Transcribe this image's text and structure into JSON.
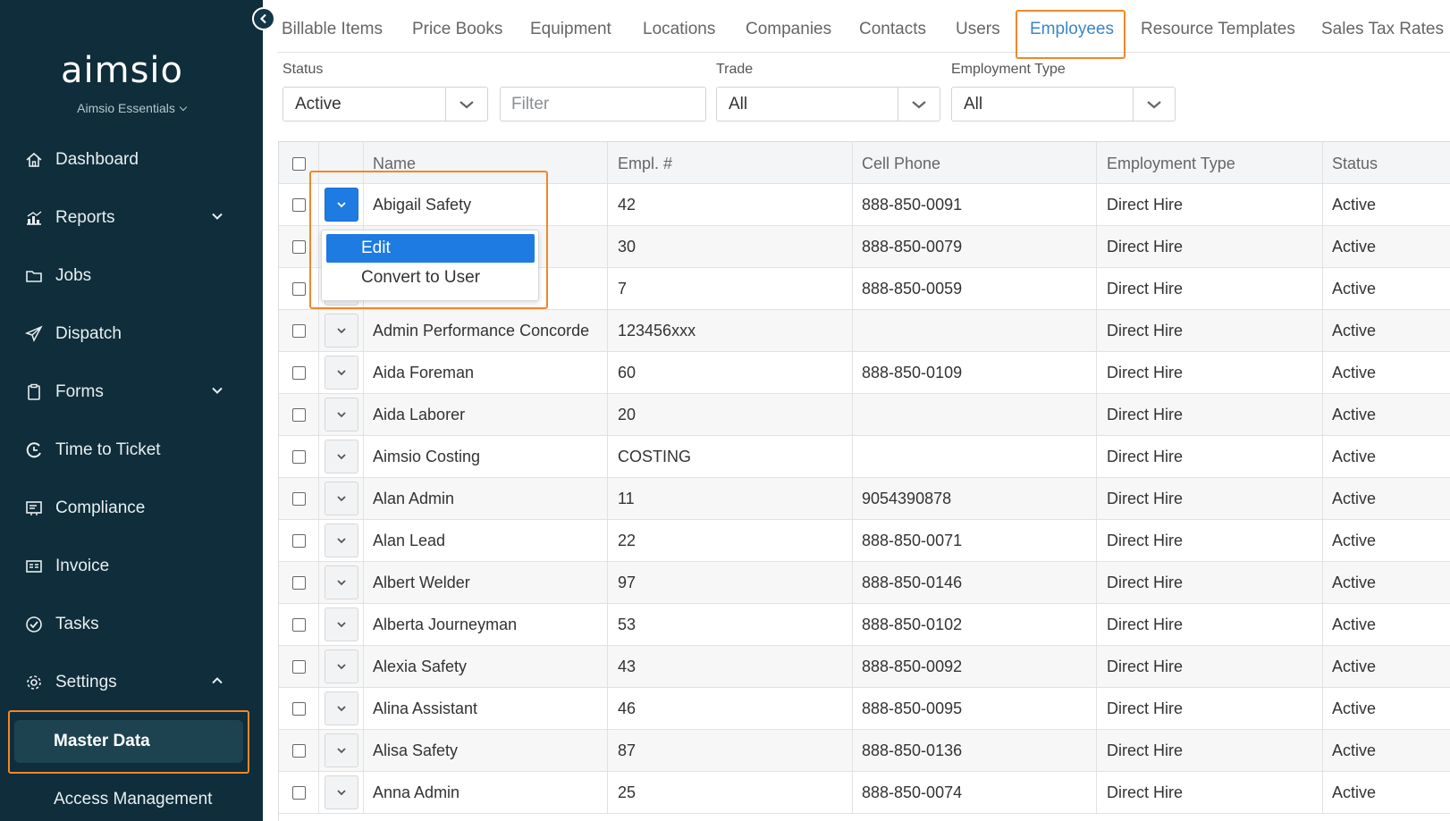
{
  "sidebar": {
    "logo": "aimsio",
    "org": "Aimsio Essentials",
    "items": [
      {
        "label": "Dashboard",
        "icon": "home-icon"
      },
      {
        "label": "Reports",
        "icon": "chart-icon"
      },
      {
        "label": "Jobs",
        "icon": "folder-icon"
      },
      {
        "label": "Dispatch",
        "icon": "send-icon"
      },
      {
        "label": "Forms",
        "icon": "clipboard-icon"
      },
      {
        "label": "Time to Ticket",
        "icon": "time-ticket-icon"
      },
      {
        "label": "Compliance",
        "icon": "compliance-icon"
      },
      {
        "label": "Invoice",
        "icon": "invoice-icon"
      },
      {
        "label": "Tasks",
        "icon": "check-circle-icon"
      },
      {
        "label": "Settings",
        "icon": "gear-icon"
      }
    ],
    "sub_items": [
      {
        "label": "Master Data",
        "active": true
      },
      {
        "label": "Access Management",
        "active": false
      }
    ]
  },
  "tabs": [
    "Billable Items",
    "Price Books",
    "Equipment",
    "Locations",
    "Companies",
    "Contacts",
    "Users",
    "Employees",
    "Resource Templates",
    "Sales Tax Rates"
  ],
  "active_tab": "Employees",
  "filters": {
    "status_label": "Status",
    "status_value": "Active",
    "filter_placeholder": "Filter",
    "trade_label": "Trade",
    "trade_value": "All",
    "employment_type_label": "Employment Type",
    "employment_type_value": "All"
  },
  "table": {
    "columns": [
      "Name",
      "Empl. #",
      "Cell Phone",
      "Employment Type",
      "Status"
    ],
    "rows": [
      {
        "name": "Abigail Safety",
        "empl": "42",
        "phone": "888-850-0091",
        "type": "Direct Hire",
        "status": "Active"
      },
      {
        "name": "",
        "empl": "30",
        "phone": "888-850-0079",
        "type": "Direct Hire",
        "status": "Active"
      },
      {
        "name": "",
        "empl": "7",
        "phone": "888-850-0059",
        "type": "Direct Hire",
        "status": "Active"
      },
      {
        "name": "Admin Performance Concorde",
        "empl": "123456xxx",
        "phone": "",
        "type": "Direct Hire",
        "status": "Active"
      },
      {
        "name": "Aida Foreman",
        "empl": "60",
        "phone": "888-850-0109",
        "type": "Direct Hire",
        "status": "Active"
      },
      {
        "name": "Aida Laborer",
        "empl": "20",
        "phone": "",
        "type": "Direct Hire",
        "status": "Active"
      },
      {
        "name": "Aimsio Costing",
        "empl": "COSTING",
        "phone": "",
        "type": "Direct Hire",
        "status": "Active"
      },
      {
        "name": "Alan Admin",
        "empl": "11",
        "phone": "9054390878",
        "type": "Direct Hire",
        "status": "Active"
      },
      {
        "name": "Alan Lead",
        "empl": "22",
        "phone": "888-850-0071",
        "type": "Direct Hire",
        "status": "Active"
      },
      {
        "name": "Albert Welder",
        "empl": "97",
        "phone": "888-850-0146",
        "type": "Direct Hire",
        "status": "Active"
      },
      {
        "name": "Alberta Journeyman",
        "empl": "53",
        "phone": "888-850-0102",
        "type": "Direct Hire",
        "status": "Active"
      },
      {
        "name": "Alexia Safety",
        "empl": "43",
        "phone": "888-850-0092",
        "type": "Direct Hire",
        "status": "Active"
      },
      {
        "name": "Alina Assistant",
        "empl": "46",
        "phone": "888-850-0095",
        "type": "Direct Hire",
        "status": "Active"
      },
      {
        "name": "Alisa Safety",
        "empl": "87",
        "phone": "888-850-0136",
        "type": "Direct Hire",
        "status": "Active"
      },
      {
        "name": "Anna Admin",
        "empl": "25",
        "phone": "888-850-0074",
        "type": "Direct Hire",
        "status": "Active"
      }
    ]
  },
  "row_menu": {
    "items": [
      "Edit",
      "Convert to User"
    ],
    "selected": "Edit"
  },
  "colors": {
    "sidebar_bg": "#0f2d3a",
    "accent_blue": "#1e7be2",
    "highlight_orange": "#f0872b",
    "tab_active": "#3a86c8"
  }
}
